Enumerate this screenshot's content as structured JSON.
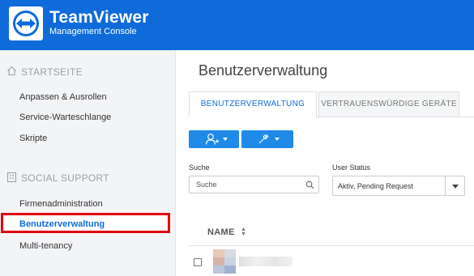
{
  "brand": {
    "title": "TeamViewer",
    "subtitle": "Management Console",
    "colors": {
      "header_bg": "#0e6bd9",
      "accent": "#1f8ae8",
      "highlight_border": "#e3000f"
    }
  },
  "sidebar": {
    "sections": [
      {
        "title": "STARTSEITE",
        "icon": "home-icon",
        "items": [
          "Anpassen & Ausrollen",
          "Service-Warteschlange",
          "Skripte"
        ]
      },
      {
        "title": "SOCIAL SUPPORT",
        "icon": "building-icon",
        "items": [
          "Firmenadministration",
          "Benutzerverwaltung",
          "Multi-tenancy"
        ],
        "active": "Benutzerverwaltung"
      }
    ]
  },
  "main": {
    "title": "Benutzerverwaltung",
    "tabs": [
      {
        "label": "BENUTZERVERWALTUNG",
        "active": true
      },
      {
        "label": "VERTRAUENSWÜRDIGE GERÄTE",
        "active": false
      }
    ],
    "toolbar": {
      "add_user_icon": "add-user-icon",
      "tools_icon": "wrench-icon"
    },
    "search": {
      "label": "Suche",
      "placeholder": "Suche"
    },
    "status": {
      "label": "User Status",
      "selected": "Aktiv, Pending Request"
    },
    "table": {
      "columns": [
        "NAME"
      ]
    }
  }
}
